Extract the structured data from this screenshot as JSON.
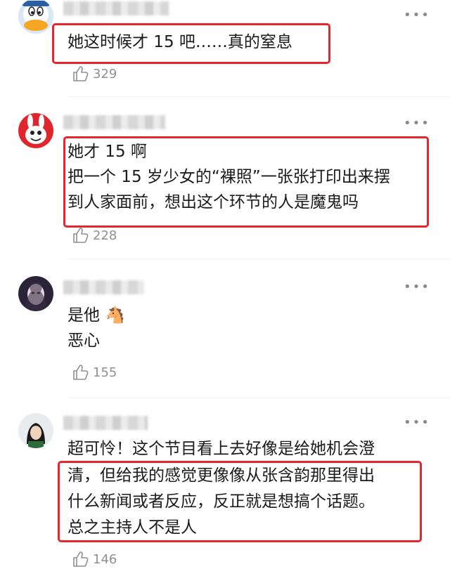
{
  "comments": [
    {
      "lines": [
        "她这时候才 15 吧……真的窒息"
      ],
      "likes": "329",
      "more_icon": "more-dots-icon"
    },
    {
      "lines": [
        "她才 15 啊",
        "把一个 15 岁少女的“裸照”一张张打印出来摆",
        "到人家面前，想出这个环节的人是魔鬼吗"
      ],
      "likes": "228",
      "more_icon": "more-dots-icon"
    },
    {
      "lines": [
        "是他 🐴",
        "恶心"
      ],
      "likes": "155",
      "more_icon": "more-dots-icon"
    },
    {
      "lines": [
        "超可怜！这个节目看上去好像是给她机会澄",
        "清，但给我的感觉更像像从张含韵那里得出",
        "什么新闻或者反应，反正就是想搞个话题。",
        "总之主持人不是人"
      ],
      "likes": "146",
      "more_icon": "more-dots-icon"
    }
  ],
  "colors": {
    "highlight": "#e8252b",
    "meta": "#8f8f8f"
  }
}
